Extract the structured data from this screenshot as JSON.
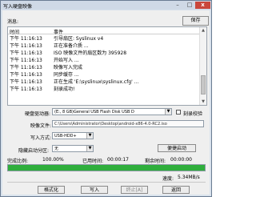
{
  "window": {
    "title": "写入硬盘映像",
    "minimize": "–",
    "maximize": "□",
    "close": "x"
  },
  "log": {
    "section_label": "消息:",
    "save_label": "保存",
    "col_time": "时间",
    "col_event": "事件",
    "rows": [
      {
        "time": "下午 11:16:13",
        "event": "引导扇区: Syslinux v4"
      },
      {
        "time": "下午 11:16:13",
        "event": "正在准备介质 ..."
      },
      {
        "time": "下午 11:16:13",
        "event": "ISO 映像文件的扇区数为 395928"
      },
      {
        "time": "下午 11:16:13",
        "event": "开始写入 ..."
      },
      {
        "time": "下午 11:16:13",
        "event": "映像写入完成"
      },
      {
        "time": "下午 11:16:13",
        "event": "同步缓存 ..."
      },
      {
        "time": "下午 11:16:13",
        "event": "正在生成 'E:\\syslinux\\syslinux.cfg' ..."
      },
      {
        "time": "下午 11:16:13",
        "event": "刻录成功!"
      }
    ],
    "scroll_up": "▲",
    "scroll_down": "▼"
  },
  "form": {
    "drive_label": "硬盘驱动器:",
    "drive_value": "(E:, 8 GB)General USB Flash Disk USB D",
    "verify_label": "刻录校验",
    "image_label": "映像文件:",
    "image_value": "C:\\Users\\Administrator\\Desktop\\android-x86-4.0-RC2.iso",
    "method_label": "写入方式:",
    "method_value": "USB-HDD+",
    "hidden_label": "隐藏启动分区:",
    "hidden_value": "无",
    "boot_button": "便捷启动",
    "dropdown_arrow": "▼"
  },
  "progress": {
    "done_label": "完成比例:",
    "done_value": "100.00%",
    "elapsed_label": "已用时间:",
    "elapsed_value": "00:00:17",
    "remain_label": "剩余时间:",
    "remain_value": "00:00:00",
    "speed_label": "速度:",
    "speed_value": "5.34MB/s",
    "fraction": 1.0
  },
  "buttons": {
    "format": "格式化",
    "write": "写入",
    "abort": "终止[A]",
    "back": "返回"
  },
  "colors": {
    "progress_fill": "#2fae3c",
    "close_bg": "#c9473b"
  }
}
